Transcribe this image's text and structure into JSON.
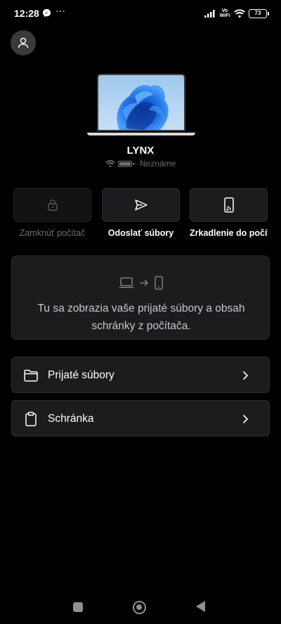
{
  "status_bar": {
    "time": "12:28",
    "dots": "···",
    "network": "Vo\nWiFi",
    "battery": "73",
    "icons": [
      "messenger-icon",
      "signal-icon",
      "wifi-icon",
      "battery-icon"
    ]
  },
  "device": {
    "name": "LYNX",
    "status": "· Neznáme"
  },
  "actions": {
    "lock_label": "Zamknúť počítač",
    "send_label": "Odoslať súbory",
    "mirror_label": "Zrkadlenie do počítača"
  },
  "info": {
    "text": "Tu sa zobrazia vaše prijaté súbory a obsah schránky z počítača."
  },
  "list": {
    "received_files": "Prijaté súbory",
    "clipboard": "Schránka"
  },
  "colors": {
    "background": "#000000",
    "card": "#1c1c1e",
    "muted": "#6e6e73",
    "accent_wallpaper": "#1e6fe0"
  }
}
